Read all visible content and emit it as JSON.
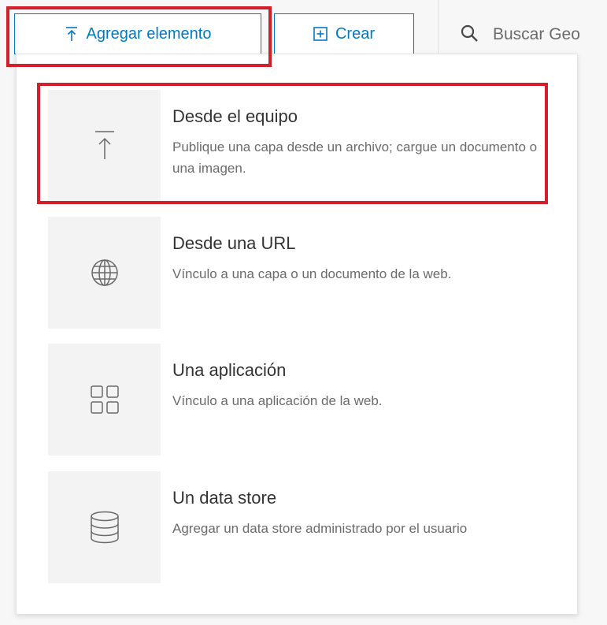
{
  "toolbar": {
    "add_item_label": "Agregar elemento",
    "create_label": "Crear",
    "search_placeholder": "Buscar Geo"
  },
  "menu": {
    "items": [
      {
        "title": "Desde el equipo",
        "description": "Publique una capa desde un archivo; cargue un documento o una imagen.",
        "icon": "upload-icon"
      },
      {
        "title": "Desde una URL",
        "description": "Vínculo a una capa o un documento de la web.",
        "icon": "globe-icon"
      },
      {
        "title": "Una aplicación",
        "description": "Vínculo a una aplicación de la web.",
        "icon": "apps-grid-icon"
      },
      {
        "title": "Un data store",
        "description": "Agregar un data store administrado por el usuario",
        "icon": "database-icon"
      }
    ]
  },
  "colors": {
    "accent": "#007ac2",
    "highlight": "#d31f2a",
    "background": "#f7f7f7",
    "icon_tile": "#f3f3f3"
  }
}
